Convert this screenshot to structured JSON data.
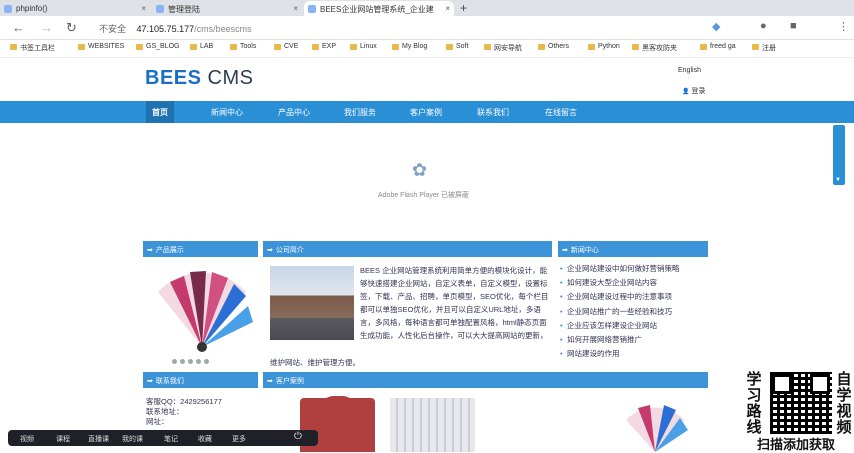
{
  "browser": {
    "tabs": [
      {
        "title": "phpinfo()",
        "active": false
      },
      {
        "title": "管理登陆",
        "active": false
      },
      {
        "title": "BEES企业网站管理系统_企业建",
        "active": true
      }
    ],
    "new_tab": "+",
    "address": {
      "security": "不安全",
      "host": "47.105.75.177",
      "path": "/cms/beescms"
    },
    "bookmarks": [
      "书签工具栏",
      "WEBSITES",
      "GS_BLOG",
      "LAB",
      "Tools",
      "CVE",
      "EXP",
      "Linux",
      "My Blog",
      "Soft",
      "网安导航",
      "Others",
      "Python",
      "黑客攻防夹",
      "freed ga",
      "注册"
    ]
  },
  "site": {
    "logo": {
      "bees": "BEES",
      "cms": " CMS"
    },
    "lang": "English",
    "login": "登录",
    "nav": [
      "首页",
      "新闻中心",
      "产品中心",
      "我们服务",
      "客户案例",
      "联系我们",
      "在线留言"
    ],
    "banner_text": "Adobe Flash Player 已被屏蔽",
    "sections": {
      "products": "产品展示",
      "about": "公司简介",
      "news": "新闻中心",
      "contact": "联系我们",
      "cases": "客户案例"
    },
    "intro": "BEES 企业网站管理系统利用简单方便的模块化设计，能够快速搭建企业网站，自定义表单，自定义模型，设置标签，下载、产品、招聘，单页模型，SEO优化，每个栏目都可以单独SEO优化，并且可以自定义URL地址，多语言，多风格，每种语言都可单独配置风格，html静态页面生成功能，人性化后台操作，可以大大提高网站的更新，",
    "intro_tail": "维护网站、维护管理方便。",
    "news_items": [
      "企业网站建设中如何做好营销策略",
      "如何建设大型企业网站内容",
      "企业网站建设过程中的注意事项",
      "企业网站推广的一些经验和技巧",
      "企业应该怎样建设企业网站",
      "如何开展网络营销推广",
      "网站建设的作用"
    ],
    "contact_lines": [
      "客服QQ：2429256177",
      "联系地址：",
      "网址："
    ]
  },
  "overlay": {
    "taskbar": [
      "视频",
      "课程",
      "直播课",
      "我的课",
      "笔记",
      "收藏",
      "更多"
    ],
    "qr_left": [
      "学",
      "习",
      "路",
      "线"
    ],
    "qr_right": [
      "自",
      "学",
      "视",
      "频"
    ],
    "qr_caption": "扫描添加获取"
  }
}
